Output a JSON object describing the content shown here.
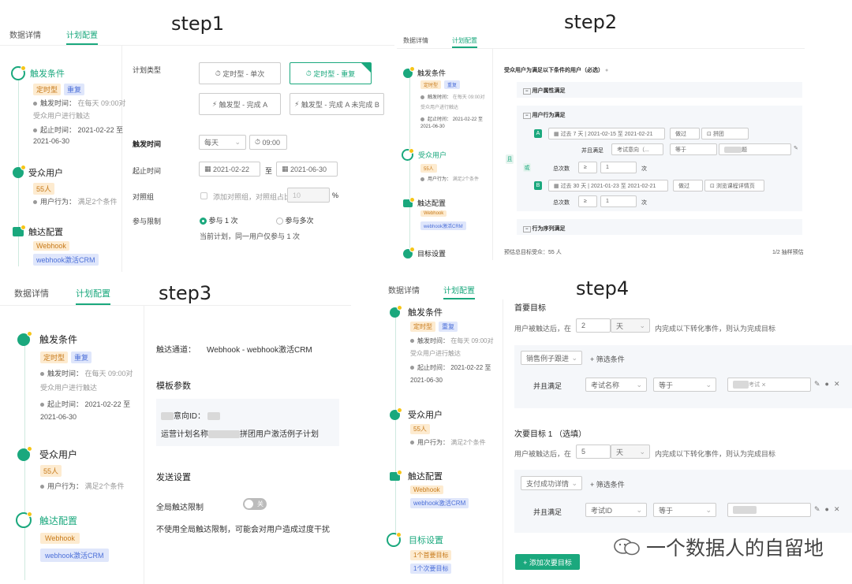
{
  "steps": [
    "step1",
    "step2",
    "step3",
    "step4"
  ],
  "tabs": {
    "details": "数据详情",
    "plan": "计划配置"
  },
  "side": {
    "trigger": "触发条件",
    "tag_timed": "定时型",
    "tag_repeat": "重复",
    "trigger_time_label": "触发时间：",
    "trigger_time_value": "在每天 09:00对",
    "trigger_time_value2": "受众用户进行触达",
    "period_label": "起止时间：",
    "period_value": "2021-02-22 至",
    "period_value2": "2021-06-30",
    "audience": "受众用户",
    "tag_users": "55人",
    "user_behavior_label": "用户行为：",
    "user_behavior_value": "满足2个条件",
    "reach": "触达配置",
    "tag_webhook": "Webhook",
    "tag_crm": "webhook激活CRM",
    "goal": "目标设置",
    "tag_goal1": "1个首要目标",
    "tag_goal2": "1个次要目标"
  },
  "s1": {
    "plan_type_label": "计划类型",
    "opt1": "定时型 - 单次",
    "opt2": "定时型 - 重复",
    "opt3": "触发型 - 完成 A",
    "opt4": "触发型 - 完成 A 未完成 B",
    "trigger_time_label": "触发时间",
    "freq": "每天",
    "time": "09:00",
    "period_label": "起止时间",
    "date_start": "2021-02-22",
    "to": "至",
    "date_end": "2021-06-30",
    "control_label": "对照组",
    "control_text": "添加对照组，对照组占比",
    "control_value": "10",
    "percent": "%",
    "limit_label": "参与限制",
    "once": "参与 1 次",
    "multi": "参与多次",
    "note": "当前计划，同一用户仅参与 1 次"
  },
  "s2": {
    "heading": "受众用户为满足以下条件的用户（必选）",
    "attr": "用户属性满足",
    "behavior": "用户行为满足",
    "and": "且",
    "or": "或",
    "a": "A",
    "b": "B",
    "a_range": "过去 7 天 | 2021-02-15 至 2021-02-21",
    "a_done": "做过",
    "a_event": "拼团",
    "also": "并且满足",
    "also_field": "考试意向（...",
    "eq": "等于",
    "blurred_suffix": "题",
    "total": "总次数",
    "ge": "≥",
    "one": "1",
    "times": "次",
    "b_range": "过去 30 天 | 2021-01-23 至 2021-02-21",
    "b_done": "做过",
    "b_event": "浏览课程详情页",
    "b_ge": "≥",
    "seq": "行为序列满足",
    "estimate": "预估总目标受众：55 人",
    "sample": "1/2 抽样预估"
  },
  "s3": {
    "channel_label": "触达通道：",
    "channel_value": "Webhook - webhook激活CRM",
    "tpl_heading": "模板参数",
    "p1_label": "意向ID：",
    "p2_label": "运营计划名称",
    "p2_value": "拼团用户激活例子计划",
    "send_heading": "发送设置",
    "global_limit": "全局触达限制",
    "toggle_off": "关",
    "note": "不使用全局触达限制，可能会对用户造成过度干扰"
  },
  "s4": {
    "primary": "首要目标",
    "reach_after": "用户被触达后，在",
    "days1": "2",
    "unit": "天",
    "finish": "内完成以下转化事件，则认为完成目标",
    "event1": "销售例子跟进",
    "filter": "+ 筛选条件",
    "also": "并且满足",
    "field1": "考试名称",
    "eq": "等于",
    "val1": "考试",
    "secondary": "次要目标 1 （选填）",
    "days2": "5",
    "event2": "支付成功详情",
    "field2": "考试ID",
    "add": "+ 添加次要目标"
  },
  "watermark": "一个数据人的自留地"
}
